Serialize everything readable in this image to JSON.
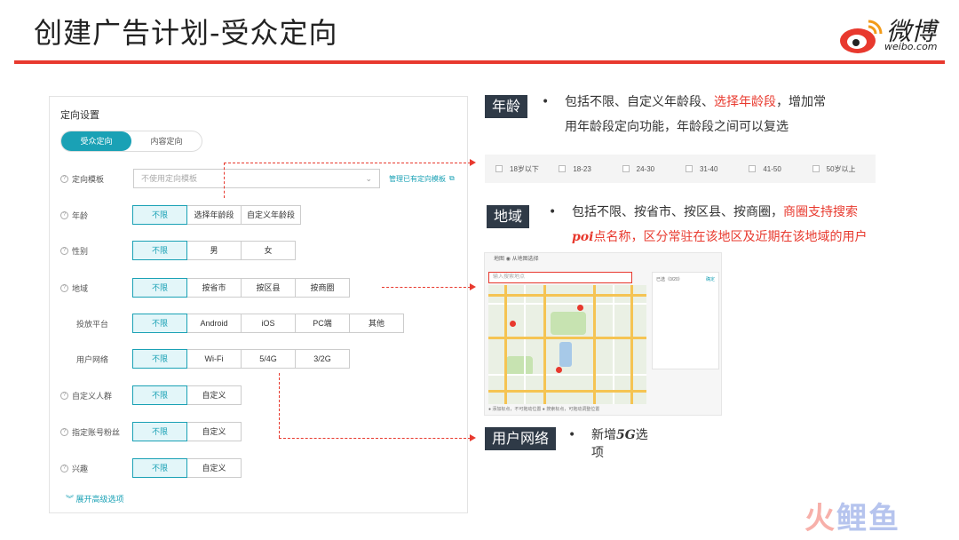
{
  "slide": {
    "title": "创建广告计划-受众定向"
  },
  "logo": {
    "text": "微博",
    "sub": "weibo.com"
  },
  "form": {
    "title": "定向设置",
    "tabs": [
      {
        "label": "受众定向",
        "active": true
      },
      {
        "label": "内容定向",
        "active": false
      }
    ],
    "template": {
      "label": "定向模板",
      "placeholder": "不使用定向模板",
      "link": "管理已有定向模板"
    },
    "rows": [
      {
        "key": "age",
        "label": "年龄",
        "options": [
          "不限",
          "选择年龄段",
          "自定义年龄段"
        ]
      },
      {
        "key": "gender",
        "label": "性别",
        "options": [
          "不限",
          "男",
          "女"
        ]
      },
      {
        "key": "region",
        "label": "地域",
        "options": [
          "不限",
          "按省市",
          "按区县",
          "按商圈"
        ]
      },
      {
        "key": "platform",
        "label": "投放平台",
        "options": [
          "不限",
          "Android",
          "iOS",
          "PC端",
          "其他"
        ]
      },
      {
        "key": "network",
        "label": "用户网络",
        "options": [
          "不限",
          "Wi-Fi",
          "5/4G",
          "3/2G"
        ]
      },
      {
        "key": "custom",
        "label": "自定义人群",
        "options": [
          "不限",
          "自定义"
        ]
      },
      {
        "key": "fans",
        "label": "指定账号粉丝",
        "options": [
          "不限",
          "自定义"
        ]
      },
      {
        "key": "interest",
        "label": "兴趣",
        "options": [
          "不限",
          "自定义"
        ]
      }
    ],
    "expand_label": "展开高级选项"
  },
  "notes": {
    "age": {
      "tag": "年龄",
      "bullet": "•",
      "text_a": "包括不限、自定义年龄段、",
      "text_red": "选择年龄段",
      "text_b": "，增加常",
      "text_line2": "用年龄段定向功能，年龄段之间可以复选"
    },
    "age_options": [
      "18岁以下",
      "18-23",
      "24-30",
      "31-40",
      "41-50",
      "50岁以上"
    ],
    "region": {
      "tag": "地域",
      "bullet": "•",
      "text_a": "包括不限、按省市、按区县、按商圈，",
      "text_red": "商圈支持搜索",
      "text_poi": "poi",
      "text_line2": "点名称，区分常驻在该地区及近期在该地域的用户"
    },
    "network": {
      "tag": "用户网络",
      "bullet": "•",
      "text_a": "新增",
      "text_5g": "5G",
      "text_b": "选",
      "text_line2": "项"
    }
  },
  "map": {
    "head": "地图  ◉ 从地图选择",
    "search_placeholder": "输入搜索地点",
    "side_title": "已选（0/20）",
    "side_link": "确定",
    "footer": "● 添加标点，不可拖动位置    ● 搜索标点，可拖动调整位置"
  },
  "watermark": {
    "a": "火",
    "b": "鲤鱼"
  },
  "colors": {
    "accent": "#1aa1b5",
    "red": "#e8392e",
    "tag_bg": "#2f3a47"
  }
}
